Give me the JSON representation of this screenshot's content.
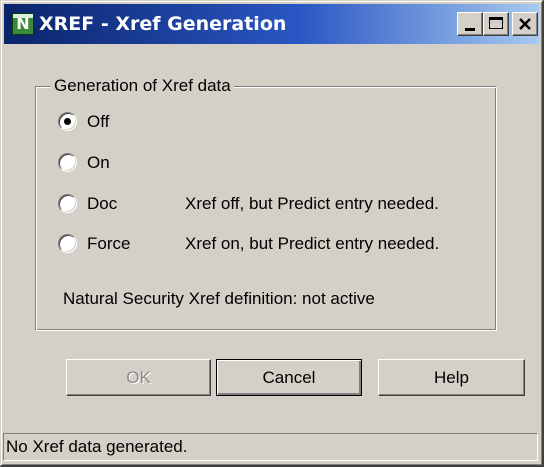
{
  "window": {
    "title": "XREF - Xref Generation",
    "icon_name": "natural-app-icon",
    "icon_letter": "N",
    "title_bar_colors": [
      "#0a246a",
      "#a6caf0"
    ]
  },
  "title_buttons": {
    "minimize_icon": "minimize-icon",
    "maximize_icon": "maximize-icon",
    "close_icon": "close-icon"
  },
  "group": {
    "legend": "Generation of Xref data",
    "selected": "Off",
    "options": [
      {
        "label": "Off",
        "description": ""
      },
      {
        "label": "On",
        "description": ""
      },
      {
        "label": "Doc",
        "description": "Xref off, but Predict entry needed."
      },
      {
        "label": "Force",
        "description": "Xref on, but Predict entry needed."
      }
    ],
    "security_text": "Natural Security Xref definition: not active"
  },
  "buttons": {
    "ok": "OK",
    "cancel": "Cancel",
    "help": "Help"
  },
  "status": "No Xref data generated."
}
